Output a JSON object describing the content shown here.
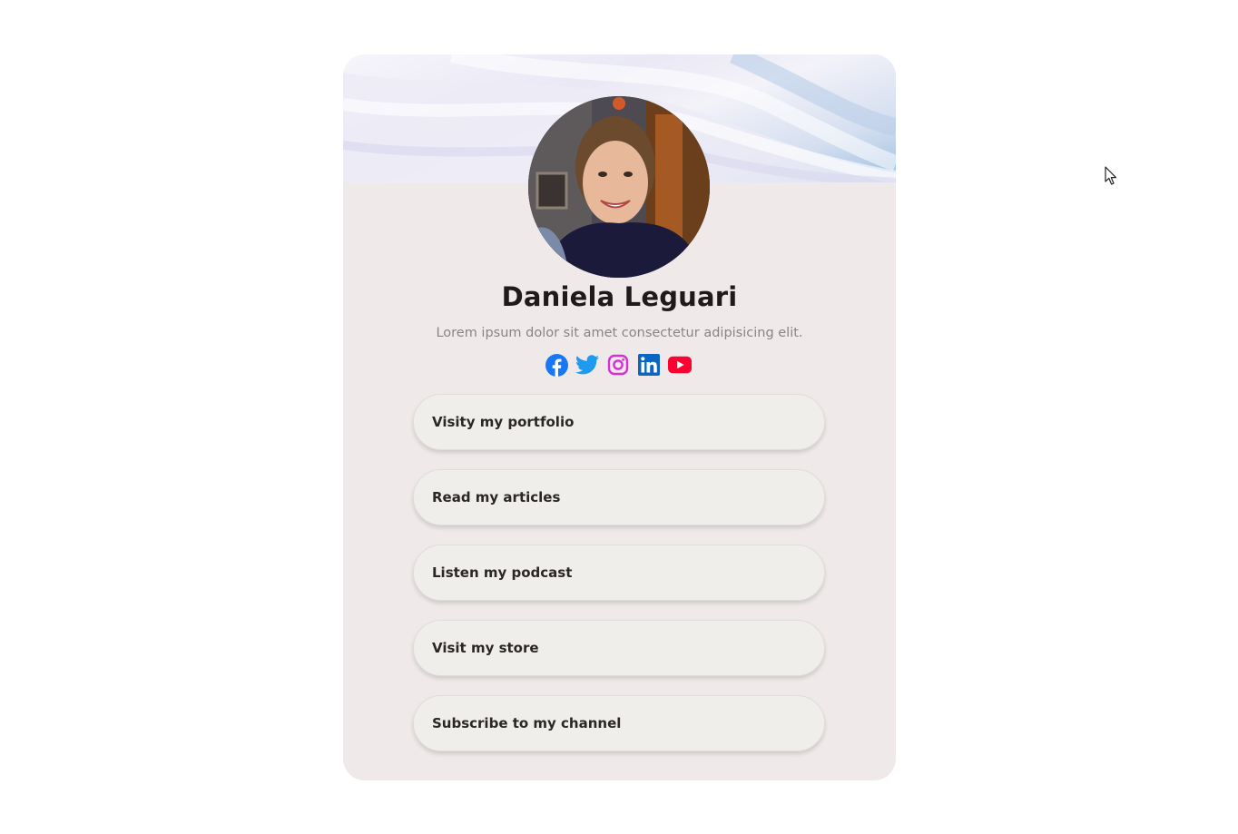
{
  "profile": {
    "name": "Daniela Leguari",
    "bio": "Lorem ipsum dolor sit amet consectetur adipisicing elit."
  },
  "socials": [
    {
      "icon": "facebook-icon",
      "color": "#1877f2"
    },
    {
      "icon": "twitter-icon",
      "color": "#1d9bf0"
    },
    {
      "icon": "instagram-icon",
      "color": "#e1306c"
    },
    {
      "icon": "linkedin-icon",
      "color": "#0a66c2"
    },
    {
      "icon": "youtube-icon",
      "color": "#ff0000"
    }
  ],
  "links": [
    {
      "label": "Visity my portfolio"
    },
    {
      "label": "Read my articles"
    },
    {
      "label": "Listen my podcast"
    },
    {
      "label": "Visit my store"
    },
    {
      "label": "Subscribe to my channel"
    }
  ],
  "colors": {
    "card_background": "#efe9e9",
    "button_background": "#f0eeeb",
    "name_text": "#1f1b1b",
    "bio_text": "#8a8585"
  }
}
